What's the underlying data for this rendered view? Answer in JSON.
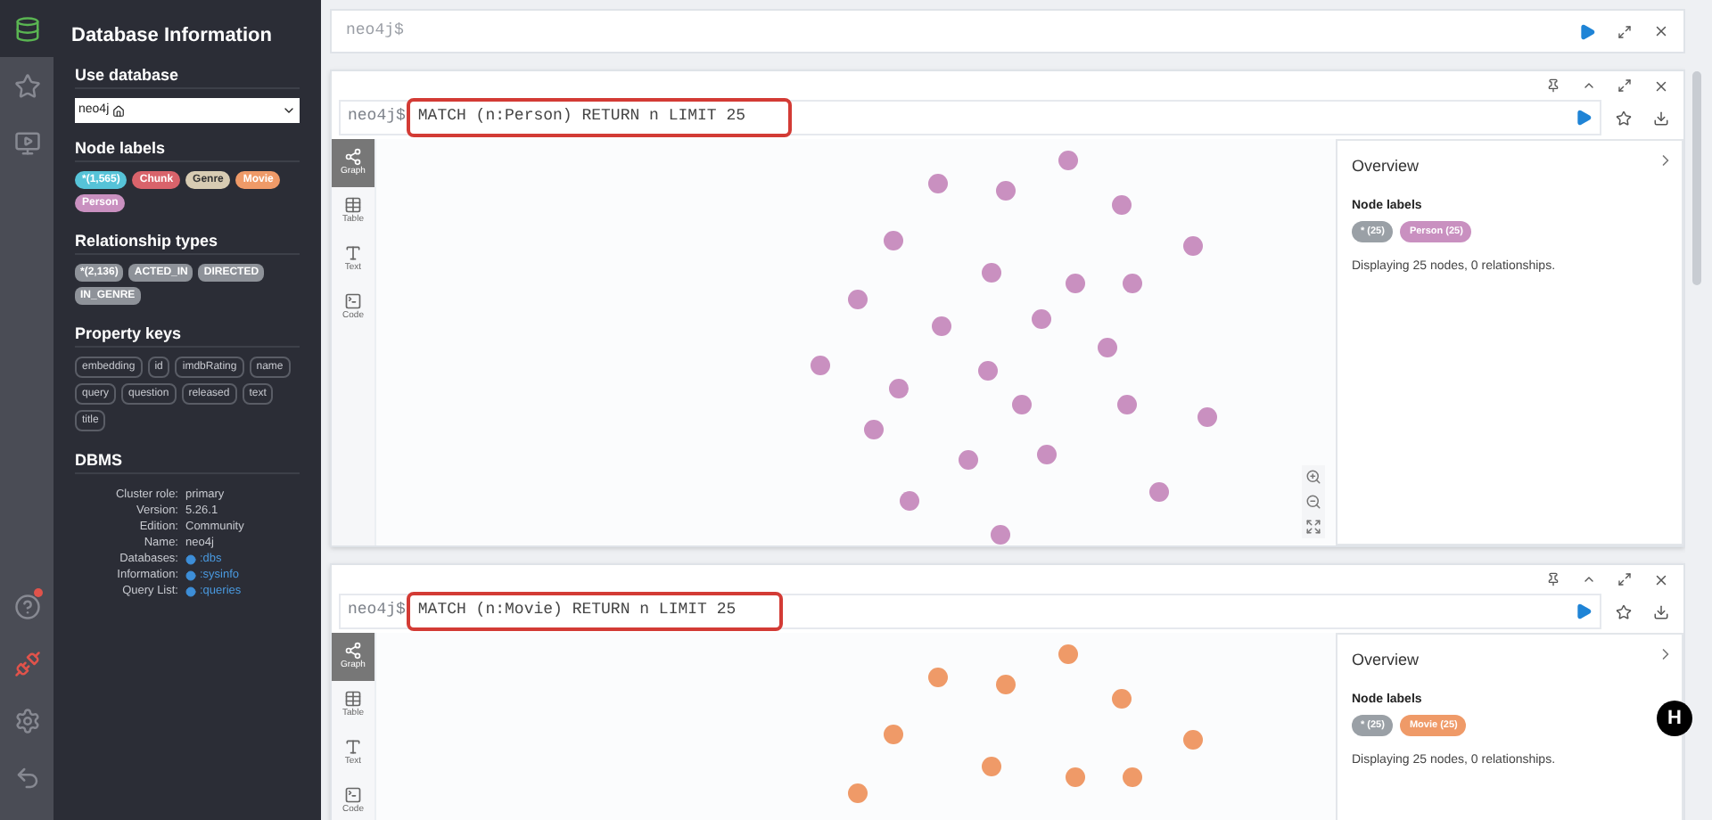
{
  "nav": [
    {
      "kind": "database",
      "selected": true,
      "notification": false
    },
    {
      "kind": "favorites",
      "selected": false,
      "notification": false
    },
    {
      "kind": "guides",
      "selected": false,
      "notification": false
    },
    {
      "kind": "help",
      "selected": false,
      "notification": true
    },
    {
      "kind": "connection",
      "selected": false,
      "notification": false
    },
    {
      "kind": "settings",
      "selected": false,
      "notification": false
    },
    {
      "kind": "about",
      "selected": false,
      "notification": false
    }
  ],
  "sidebar": {
    "title": "Database Information",
    "use_database": {
      "label": "Use database",
      "value": "neo4j"
    },
    "node_labels": {
      "heading": "Node labels",
      "tags": [
        {
          "text": "*(1,565)",
          "color": "#56c3d8"
        },
        {
          "text": "Chunk",
          "color": "#d9636b"
        },
        {
          "text": "Genre",
          "color": "#d8ccb3"
        },
        {
          "text": "Movie",
          "color": "#ef9a68"
        },
        {
          "text": "Person",
          "color": "#c990c0"
        }
      ]
    },
    "relationship_types": {
      "heading": "Relationship types",
      "tags": [
        "*(2,136)",
        "ACTED_IN",
        "DIRECTED",
        "IN_GENRE"
      ]
    },
    "property_keys": {
      "heading": "Property keys",
      "tags": [
        "embedding",
        "id",
        "imdbRating",
        "name",
        "query",
        "question",
        "released",
        "text",
        "title"
      ]
    },
    "dbms": {
      "heading": "DBMS",
      "rows": [
        {
          "label": "Cluster role:",
          "value": "primary",
          "link": false
        },
        {
          "label": "Version:",
          "value": "5.26.1",
          "link": false
        },
        {
          "label": "Edition:",
          "value": "Community",
          "link": false
        },
        {
          "label": "Name:",
          "value": "neo4j",
          "link": false
        },
        {
          "label": "Databases:",
          "value": ":dbs",
          "link": true
        },
        {
          "label": "Information:",
          "value": ":sysinfo",
          "link": true
        },
        {
          "label": "Query List:",
          "value": ":queries",
          "link": true
        }
      ]
    }
  },
  "editor": {
    "prompt": "neo4j$"
  },
  "frames": [
    {
      "prompt": "neo4j$",
      "query": "MATCH (n:Person) RETURN n LIMIT 25",
      "highlighted": true,
      "views": [
        {
          "label": "Graph",
          "selected": true
        },
        {
          "label": "Table",
          "selected": false
        },
        {
          "label": "Text",
          "selected": false
        },
        {
          "label": "Code",
          "selected": false
        }
      ],
      "overview": {
        "title": "Overview",
        "heading": "Node labels",
        "tags": [
          {
            "text": "* (25)",
            "color": "#9aa0a6"
          },
          {
            "text": "Person (25)",
            "color": "#c990c0"
          }
        ],
        "summary": "Displaying 25 nodes, 0 relationships."
      }
    },
    {
      "prompt": "neo4j$",
      "query": "MATCH (n:Movie) RETURN n LIMIT 25",
      "highlighted": true,
      "views": [
        {
          "label": "Graph",
          "selected": true
        },
        {
          "label": "Table",
          "selected": false
        },
        {
          "label": "Text",
          "selected": false
        },
        {
          "label": "Code",
          "selected": false
        }
      ],
      "overview": {
        "title": "Overview",
        "heading": "Node labels",
        "tags": [
          {
            "text": "* (25)",
            "color": "#9aa0a6"
          },
          {
            "text": "Movie (25)",
            "color": "#ef9a68"
          }
        ],
        "summary": "Displaying 25 nodes, 0 relationships."
      }
    }
  ],
  "floating_button": "H"
}
